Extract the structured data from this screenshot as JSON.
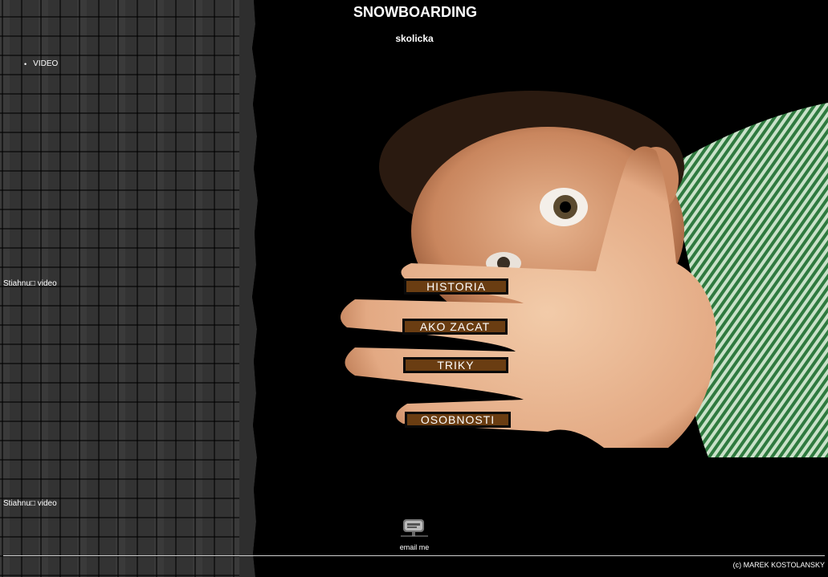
{
  "header": {
    "title": "SNOWBOARDING",
    "subtitle": "skolicka"
  },
  "sidebar": {
    "nav_items": [
      {
        "label": "VIDEO"
      }
    ],
    "download_links": [
      {
        "label": "Stiahnu□ video"
      },
      {
        "label": "Stiahnu□ video"
      }
    ]
  },
  "menu": {
    "historia": "HISTORIA",
    "ako_zacat": "AKO ZACAT",
    "triky": "TRIKY",
    "osobnosti": "OSOBNOSTI"
  },
  "footer": {
    "email_label": "email me",
    "copyright": "(c) MAREK KOSTOLANSKY"
  },
  "colors": {
    "background": "#000000",
    "button_fill": "#6a3d12",
    "button_border": "#0a0a0a",
    "sidebar_tile": "#3a3a3a"
  },
  "icons": {
    "email": "mailbox-icon"
  }
}
